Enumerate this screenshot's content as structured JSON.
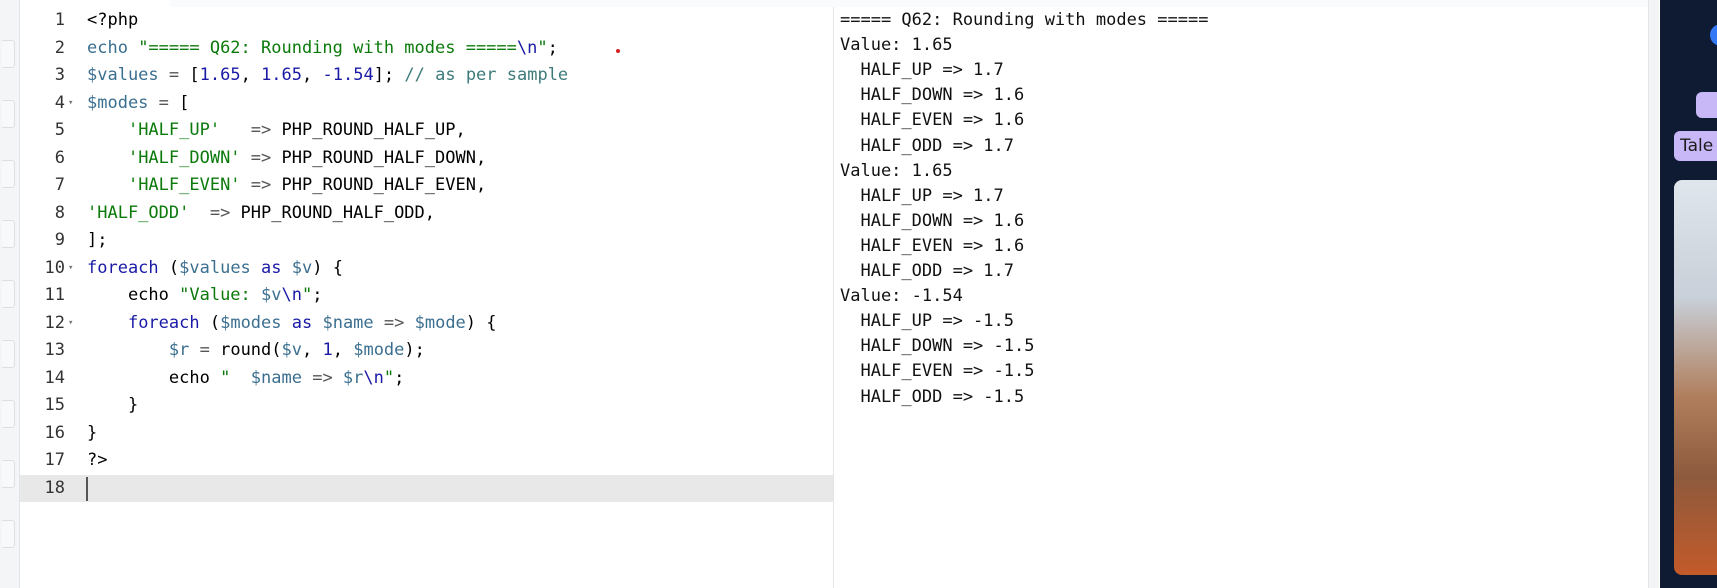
{
  "editor": {
    "lines": [
      {
        "n": "1",
        "fold": false,
        "tokens": [
          {
            "t": "<?php",
            "c": ""
          }
        ]
      },
      {
        "n": "2",
        "fold": false,
        "tokens": [
          {
            "t": "echo ",
            "c": "var"
          },
          {
            "t": "\"===== Q62: Rounding with modes =====",
            "c": "str"
          },
          {
            "t": "\\n",
            "c": "kw"
          },
          {
            "t": "\"",
            "c": "str"
          },
          {
            "t": ";",
            "c": ""
          }
        ]
      },
      {
        "n": "3",
        "fold": false,
        "tokens": [
          {
            "t": "$values",
            "c": "var"
          },
          {
            "t": " = ",
            "c": "op"
          },
          {
            "t": "[",
            "c": ""
          },
          {
            "t": "1.65",
            "c": "num"
          },
          {
            "t": ", ",
            "c": ""
          },
          {
            "t": "1.65",
            "c": "num"
          },
          {
            "t": ", ",
            "c": ""
          },
          {
            "t": "-1.54",
            "c": "num"
          },
          {
            "t": "]; ",
            "c": ""
          },
          {
            "t": "// as per sample",
            "c": "com"
          }
        ]
      },
      {
        "n": "4",
        "fold": true,
        "tokens": [
          {
            "t": "$modes",
            "c": "var"
          },
          {
            "t": " = ",
            "c": "op"
          },
          {
            "t": "[",
            "c": ""
          }
        ]
      },
      {
        "n": "5",
        "fold": false,
        "tokens": [
          {
            "t": "    ",
            "c": ""
          },
          {
            "t": "'HALF_UP'",
            "c": "str"
          },
          {
            "t": "   => ",
            "c": "op"
          },
          {
            "t": "PHP_ROUND_HALF_UP,",
            "c": ""
          }
        ]
      },
      {
        "n": "6",
        "fold": false,
        "tokens": [
          {
            "t": "    ",
            "c": ""
          },
          {
            "t": "'HALF_DOWN'",
            "c": "str"
          },
          {
            "t": " => ",
            "c": "op"
          },
          {
            "t": "PHP_ROUND_HALF_DOWN,",
            "c": ""
          }
        ]
      },
      {
        "n": "7",
        "fold": false,
        "tokens": [
          {
            "t": "    ",
            "c": ""
          },
          {
            "t": "'HALF_EVEN'",
            "c": "str"
          },
          {
            "t": " => ",
            "c": "op"
          },
          {
            "t": "PHP_ROUND_HALF_EVEN,",
            "c": ""
          }
        ]
      },
      {
        "n": "8",
        "fold": false,
        "tokens": [
          {
            "t": "'HALF_ODD'",
            "c": "str"
          },
          {
            "t": "  => ",
            "c": "op"
          },
          {
            "t": "PHP_ROUND_HALF_ODD,",
            "c": ""
          }
        ]
      },
      {
        "n": "9",
        "fold": false,
        "tokens": [
          {
            "t": "];",
            "c": ""
          }
        ]
      },
      {
        "n": "10",
        "fold": true,
        "tokens": [
          {
            "t": "foreach",
            "c": "kw"
          },
          {
            "t": " (",
            "c": ""
          },
          {
            "t": "$values",
            "c": "var"
          },
          {
            "t": " as ",
            "c": "kw"
          },
          {
            "t": "$v",
            "c": "var"
          },
          {
            "t": ") {",
            "c": ""
          }
        ]
      },
      {
        "n": "11",
        "fold": false,
        "tokens": [
          {
            "t": "    echo ",
            "c": ""
          },
          {
            "t": "\"Value: ",
            "c": "str"
          },
          {
            "t": "$v",
            "c": "var"
          },
          {
            "t": "\\n",
            "c": "kw"
          },
          {
            "t": "\"",
            "c": "str"
          },
          {
            "t": ";",
            "c": ""
          }
        ]
      },
      {
        "n": "12",
        "fold": true,
        "tokens": [
          {
            "t": "    ",
            "c": ""
          },
          {
            "t": "foreach",
            "c": "kw"
          },
          {
            "t": " (",
            "c": ""
          },
          {
            "t": "$modes",
            "c": "var"
          },
          {
            "t": " as ",
            "c": "kw"
          },
          {
            "t": "$name",
            "c": "var"
          },
          {
            "t": " => ",
            "c": "op"
          },
          {
            "t": "$mode",
            "c": "var"
          },
          {
            "t": ") {",
            "c": ""
          }
        ]
      },
      {
        "n": "13",
        "fold": false,
        "tokens": [
          {
            "t": "        ",
            "c": ""
          },
          {
            "t": "$r",
            "c": "var"
          },
          {
            "t": " = ",
            "c": "op"
          },
          {
            "t": "round(",
            "c": ""
          },
          {
            "t": "$v",
            "c": "var"
          },
          {
            "t": ", ",
            "c": ""
          },
          {
            "t": "1",
            "c": "num"
          },
          {
            "t": ", ",
            "c": ""
          },
          {
            "t": "$mode",
            "c": "var"
          },
          {
            "t": ");",
            "c": ""
          }
        ]
      },
      {
        "n": "14",
        "fold": false,
        "tokens": [
          {
            "t": "        echo ",
            "c": ""
          },
          {
            "t": "\"  ",
            "c": "str"
          },
          {
            "t": "$name",
            "c": "var"
          },
          {
            "t": " => ",
            "c": "op"
          },
          {
            "t": "$r",
            "c": "var"
          },
          {
            "t": "\\n",
            "c": "kw"
          },
          {
            "t": "\"",
            "c": "str"
          },
          {
            "t": ";",
            "c": ""
          }
        ]
      },
      {
        "n": "15",
        "fold": false,
        "tokens": [
          {
            "t": "    }",
            "c": ""
          }
        ]
      },
      {
        "n": "16",
        "fold": false,
        "tokens": [
          {
            "t": "}",
            "c": ""
          }
        ]
      },
      {
        "n": "17",
        "fold": false,
        "tokens": [
          {
            "t": "?>",
            "c": ""
          }
        ]
      },
      {
        "n": "18",
        "fold": false,
        "tokens": [
          {
            "t": "",
            "c": ""
          }
        ]
      }
    ]
  },
  "output": {
    "lines": [
      "===== Q62: Rounding with modes =====",
      "Value: 1.65",
      "  HALF_UP => 1.7",
      "  HALF_DOWN => 1.6",
      "  HALF_EVEN => 1.6",
      "  HALF_ODD => 1.7",
      "Value: 1.65",
      "  HALF_UP => 1.7",
      "  HALF_DOWN => 1.6",
      "  HALF_EVEN => 1.6",
      "  HALF_ODD => 1.7",
      "Value: -1.54",
      "  HALF_UP => -1.5",
      "  HALF_DOWN => -1.5",
      "  HALF_EVEN => -1.5",
      "  HALF_ODD => -1.5"
    ]
  },
  "side_panel": {
    "tag_label": "Tale"
  },
  "colors": {
    "keyword": "#1a1aa6",
    "variable": "#3b6f8f",
    "string": "#0b7a0b",
    "comment": "#3d7a7a",
    "active_line": "#e8e8e8"
  }
}
